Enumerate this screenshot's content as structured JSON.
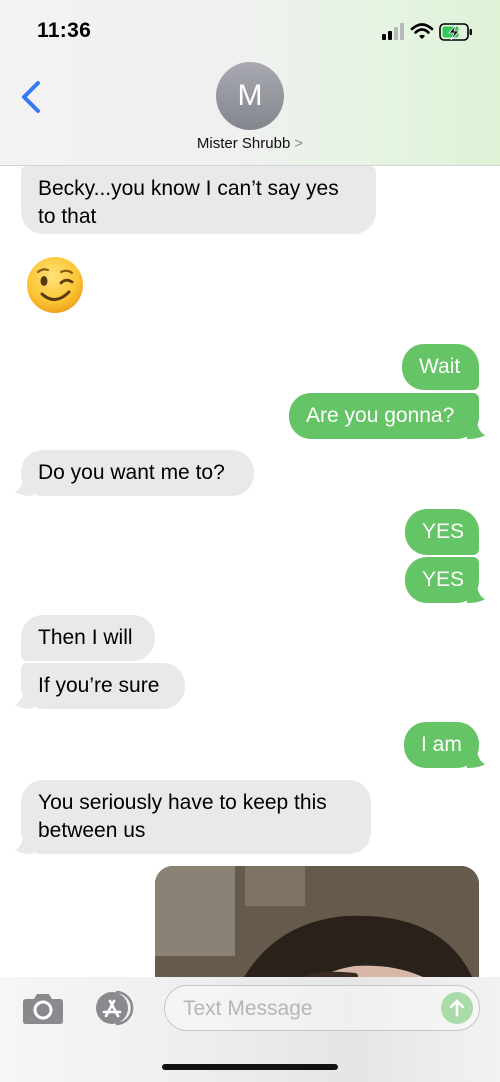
{
  "status": {
    "time": "11:36"
  },
  "header": {
    "avatar_initial": "M",
    "contact_name": "Mister Shrubb",
    "chevron": ">"
  },
  "messages": [
    {
      "dir": "in",
      "text": "Becky...you know I can’t say yes to that"
    },
    {
      "dir": "in",
      "emoji": "winking-face"
    },
    {
      "dir": "out",
      "text": "Wait"
    },
    {
      "dir": "out",
      "text": "Are you gonna?"
    },
    {
      "dir": "in",
      "text": "Do you want me to?"
    },
    {
      "dir": "out",
      "text": "YES"
    },
    {
      "dir": "out",
      "text": "YES"
    },
    {
      "dir": "in",
      "text": "Then I will"
    },
    {
      "dir": "in",
      "text": "If you’re sure"
    },
    {
      "dir": "out",
      "text": "I am"
    },
    {
      "dir": "in",
      "text": "You seriously have to keep this between us"
    },
    {
      "dir": "in",
      "attachment": "photo"
    }
  ],
  "composer": {
    "placeholder": "Text Message"
  },
  "colors": {
    "incoming": "#e9e9eb",
    "outgoing": "#65c466",
    "accent": "#3478f6"
  },
  "icons": [
    "back-chevron-icon",
    "camera-icon",
    "app-store-icon",
    "send-arrow-icon",
    "signal-icon",
    "wifi-icon",
    "battery-charging-icon"
  ]
}
